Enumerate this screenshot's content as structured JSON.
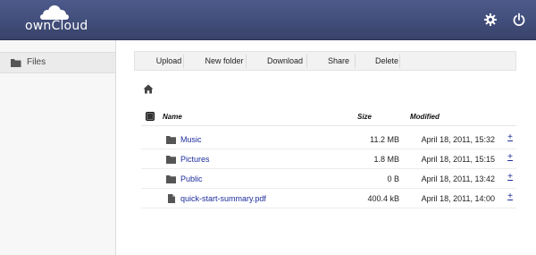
{
  "header": {
    "brand": "ownCloud",
    "settings_icon": "gear-icon",
    "logout_icon": "power-icon"
  },
  "sidebar": {
    "items": [
      {
        "label": "Files",
        "icon": "folder-icon"
      }
    ]
  },
  "controls": {
    "upload": "Upload",
    "new_folder": "New folder",
    "download": "Download",
    "share": "Share",
    "delete": "Delete"
  },
  "breadcrumb": {
    "icon": "home-icon"
  },
  "table": {
    "columns": {
      "name": "Name",
      "size": "Size",
      "modified": "Modified"
    },
    "rows": [
      {
        "name": "Music",
        "type": "folder",
        "size": "11.2 MB",
        "modified": "April 18, 2011, 15:32",
        "action": "+"
      },
      {
        "name": "Pictures",
        "type": "folder",
        "size": "1.8 MB",
        "modified": "April 18, 2011, 15:15",
        "action": "+"
      },
      {
        "name": "Public",
        "type": "folder",
        "size": "0 B",
        "modified": "April 18, 2011, 13:42",
        "action": "+"
      },
      {
        "name": "quick-start-summary.pdf",
        "type": "file",
        "size": "400.4 kB",
        "modified": "April 18, 2011, 14:00",
        "action": "+"
      }
    ]
  },
  "colors": {
    "header": "#434e7c",
    "link": "#1d2d9c",
    "sidebar": "#f7f7f7"
  }
}
